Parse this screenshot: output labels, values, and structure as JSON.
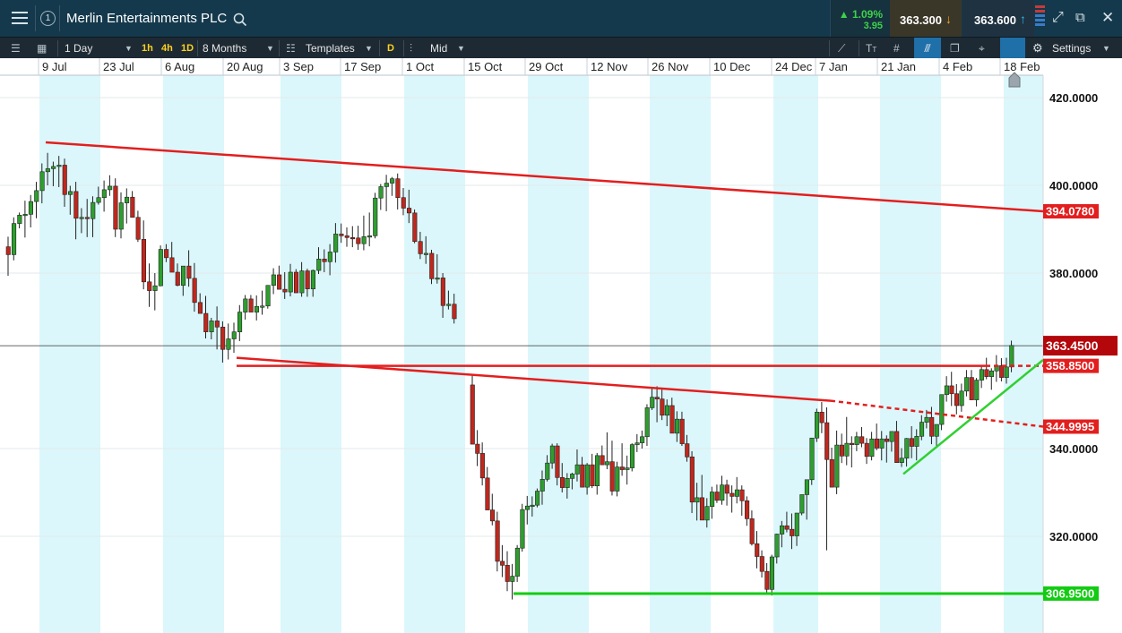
{
  "header": {
    "title": "Merlin Entertainments PLC",
    "badge_number": "1",
    "change_percent": "1.09%",
    "change_value": "3.95",
    "sell_price": "363.300",
    "buy_price": "363.600",
    "colors": {
      "bar": "#14394c",
      "up": "#3fd14a",
      "sell_bg": "#3a3a2e",
      "buy_bg": "#1f3140"
    }
  },
  "toolbar": {
    "interval": "1 Day",
    "quick_1h": "1h",
    "quick_4h": "4h",
    "quick_1d": "1D",
    "range": "8 Months",
    "templates": "Templates",
    "d_badge": "D",
    "price_type": "Mid",
    "text_tool": "T",
    "settings": "Settings"
  },
  "chart_data": {
    "type": "candlestick",
    "xlabels": [
      "9 Jul",
      "23 Jul",
      "6 Aug",
      "20 Aug",
      "3 Sep",
      "17 Sep",
      "1 Oct",
      "15 Oct",
      "29 Oct",
      "12 Nov",
      "26 Nov",
      "10 Dec",
      "24 Dec",
      "7 Jan",
      "21 Jan",
      "4 Feb",
      "18 Feb"
    ],
    "y_ticks": [
      "420.0000",
      "400.0000",
      "380.0000",
      "340.0000",
      "320.0000"
    ],
    "ylim": [
      294,
      425
    ],
    "current_price": "363.4500",
    "levels": [
      {
        "label": "394.0780",
        "color": "#e31e1e"
      },
      {
        "label": "358.8500",
        "color": "#e31e1e"
      },
      {
        "label": "344.9995",
        "color": "#e31e1e"
      },
      {
        "label": "306.9500",
        "color": "#12cc12"
      }
    ],
    "candles": [
      [
        386.0,
        388.3,
        379.4,
        384.2
      ],
      [
        384.2,
        392.7,
        382.9,
        391.3
      ],
      [
        391.3,
        393.8,
        390.2,
        393.2
      ],
      [
        393.2,
        396.5,
        388.1,
        393.4
      ],
      [
        393.4,
        397.8,
        390.4,
        396.3
      ],
      [
        396.3,
        400.8,
        392.5,
        398.8
      ],
      [
        398.8,
        405.0,
        395.9,
        403.1
      ],
      [
        403.1,
        407.4,
        400.0,
        403.8
      ],
      [
        403.8,
        405.4,
        399.8,
        404.3
      ],
      [
        404.3,
        406.7,
        399.6,
        404.6
      ],
      [
        404.6,
        406.1,
        395.1,
        397.9
      ],
      [
        397.9,
        399.9,
        393.3,
        398.6
      ],
      [
        398.6,
        400.8,
        387.7,
        392.5
      ],
      [
        392.5,
        394.8,
        389.1,
        392.7
      ],
      [
        392.7,
        396.9,
        388.2,
        392.4
      ],
      [
        392.4,
        397.5,
        388.2,
        396.1
      ],
      [
        396.1,
        399.7,
        395.6,
        397.2
      ],
      [
        397.2,
        401.1,
        394.0,
        399.0
      ],
      [
        399.0,
        402.3,
        397.6,
        399.8
      ],
      [
        399.8,
        401.6,
        388.2,
        390.0
      ],
      [
        390.0,
        398.4,
        387.9,
        396.0
      ],
      [
        396.0,
        399.3,
        391.3,
        397.3
      ],
      [
        397.3,
        398.7,
        393.0,
        392.7
      ],
      [
        392.7,
        394.2,
        387.1,
        387.7
      ],
      [
        387.7,
        392.0,
        376.3,
        378.0
      ],
      [
        378.0,
        382.2,
        372.3,
        376.0
      ],
      [
        376.0,
        380.0,
        371.5,
        377.1
      ],
      [
        377.1,
        386.3,
        377.0,
        385.4
      ],
      [
        385.4,
        386.6,
        382.5,
        383.5
      ],
      [
        383.5,
        387.1,
        382.1,
        380.2
      ],
      [
        380.2,
        382.2,
        377.0,
        377.2
      ],
      [
        377.2,
        381.0,
        374.8,
        381.6
      ],
      [
        381.6,
        385.2,
        376.9,
        378.8
      ],
      [
        378.8,
        382.3,
        371.2,
        373.3
      ],
      [
        373.3,
        375.4,
        371.6,
        370.8
      ],
      [
        370.8,
        374.8,
        365.1,
        366.6
      ],
      [
        366.6,
        369.8,
        364.9,
        369.1
      ],
      [
        369.1,
        372.4,
        362.6,
        367.7
      ],
      [
        367.7,
        369.0,
        359.6,
        362.6
      ],
      [
        362.6,
        368.5,
        360.3,
        365.0
      ],
      [
        365.0,
        368.7,
        361.8,
        366.6
      ],
      [
        366.6,
        372.7,
        364.5,
        371.1
      ],
      [
        371.1,
        375.0,
        369.4,
        374.1
      ],
      [
        374.1,
        375.0,
        371.6,
        371.1
      ],
      [
        371.1,
        374.9,
        369.2,
        372.4
      ],
      [
        372.4,
        376.0,
        370.5,
        372.5
      ],
      [
        372.5,
        377.1,
        371.9,
        377.2
      ],
      [
        377.2,
        381.1,
        375.2,
        379.6
      ],
      [
        379.6,
        381.7,
        376.6,
        376.3
      ],
      [
        376.3,
        380.2,
        374.1,
        375.7
      ],
      [
        375.7,
        382.1,
        374.7,
        380.2
      ],
      [
        380.2,
        380.9,
        375.6,
        375.5
      ],
      [
        375.5,
        382.5,
        374.6,
        380.5
      ],
      [
        380.5,
        381.0,
        374.6,
        376.4
      ],
      [
        376.4,
        380.8,
        374.6,
        380.6
      ],
      [
        380.6,
        385.9,
        379.8,
        383.2
      ],
      [
        383.2,
        385.4,
        380.2,
        382.6
      ],
      [
        382.6,
        386.6,
        379.5,
        384.8
      ],
      [
        384.8,
        391.4,
        382.4,
        388.9
      ],
      [
        388.9,
        391.3,
        386.9,
        388.5
      ],
      [
        388.5,
        390.4,
        386.0,
        388.1
      ],
      [
        388.1,
        390.7,
        385.9,
        388.0
      ],
      [
        388.0,
        390.8,
        385.3,
        386.7
      ],
      [
        386.7,
        393.1,
        385.2,
        388.3
      ],
      [
        388.3,
        393.8,
        386.1,
        388.5
      ],
      [
        388.5,
        398.3,
        387.9,
        397.1
      ],
      [
        397.1,
        400.3,
        394.4,
        399.7
      ],
      [
        399.7,
        402.4,
        394.1,
        400.5
      ],
      [
        400.5,
        401.9,
        397.6,
        401.5
      ],
      [
        401.5,
        402.7,
        394.5,
        397.2
      ],
      [
        397.2,
        399.4,
        393.2,
        394.8
      ],
      [
        394.8,
        399.0,
        391.4,
        393.7
      ],
      [
        393.7,
        394.5,
        386.8,
        387.2
      ],
      [
        387.2,
        389.4,
        383.2,
        384.4
      ],
      [
        384.4,
        388.4,
        382.1,
        384.5
      ],
      [
        384.5,
        385.3,
        377.5,
        378.7
      ],
      [
        378.7,
        384.3,
        377.6,
        378.9
      ],
      [
        378.9,
        380.0,
        369.8,
        372.6
      ],
      [
        372.6,
        376.0,
        371.7,
        372.9
      ],
      [
        372.9,
        375.3,
        368.5,
        369.6
      ]
    ],
    "candles2": [
      [
        354.5,
        357.0,
        345.0,
        341.0
      ],
      [
        341.0,
        344.2,
        336.0,
        338.9
      ],
      [
        338.9,
        341.4,
        331.6,
        333.3
      ],
      [
        333.3,
        335.8,
        330.0,
        326.0
      ],
      [
        326.0,
        329.7,
        322.5,
        323.5
      ],
      [
        323.5,
        325.6,
        312.0,
        314.3
      ],
      [
        314.3,
        318.0,
        310.7,
        313.4
      ],
      [
        313.4,
        316.6,
        307.5,
        309.7
      ],
      [
        309.7,
        313.7,
        305.6,
        310.9
      ],
      [
        310.9,
        318.0,
        309.6,
        317.3
      ],
      [
        317.3,
        327.4,
        316.5,
        326.1
      ],
      [
        326.1,
        329.2,
        322.7,
        326.9
      ],
      [
        326.9,
        329.1,
        324.5,
        327.1
      ],
      [
        327.1,
        330.9,
        326.6,
        330.3
      ],
      [
        330.3,
        335.0,
        327.2,
        333.0
      ],
      [
        333.0,
        338.5,
        332.5,
        336.7
      ],
      [
        336.7,
        341.1,
        335.4,
        340.6
      ],
      [
        340.6,
        341.2,
        331.6,
        333.4
      ],
      [
        333.4,
        336.7,
        330.0,
        331.1
      ],
      [
        331.1,
        334.4,
        328.6,
        333.2
      ],
      [
        333.2,
        334.5,
        330.7,
        334.2
      ],
      [
        334.2,
        339.8,
        332.5,
        336.3
      ],
      [
        336.3,
        338.1,
        332.0,
        331.2
      ],
      [
        331.2,
        336.7,
        329.5,
        336.3
      ],
      [
        336.3,
        338.8,
        331.0,
        331.5
      ],
      [
        331.5,
        339.0,
        329.5,
        338.4
      ],
      [
        338.4,
        340.7,
        336.7,
        336.3
      ],
      [
        336.3,
        343.7,
        335.3,
        337.0
      ],
      [
        337.0,
        341.8,
        329.3,
        330.3
      ],
      [
        330.3,
        337.0,
        329.1,
        335.8
      ],
      [
        335.8,
        341.2,
        333.8,
        335.2
      ],
      [
        335.2,
        338.4,
        331.8,
        335.6
      ],
      [
        335.6,
        341.2,
        334.8,
        340.9
      ],
      [
        340.9,
        343.3,
        339.2,
        341.3
      ],
      [
        341.3,
        344.1,
        340.0,
        342.7
      ],
      [
        342.7,
        350.1,
        340.6,
        349.3
      ],
      [
        349.3,
        353.8,
        348.8,
        351.7
      ],
      [
        351.7,
        354.2,
        346.0,
        351.3
      ],
      [
        351.3,
        353.5,
        346.5,
        347.6
      ],
      [
        347.6,
        351.2,
        345.1,
        349.8
      ],
      [
        349.8,
        351.6,
        346.2,
        343.5
      ],
      [
        343.5,
        348.5,
        341.5,
        346.7
      ],
      [
        346.7,
        348.4,
        340.6,
        341.1
      ],
      [
        341.1,
        343.1,
        337.0,
        338.1
      ],
      [
        338.1,
        339.4,
        325.3,
        327.8
      ],
      [
        327.8,
        332.2,
        323.6,
        328.8
      ],
      [
        328.8,
        334.0,
        325.6,
        323.7
      ],
      [
        323.7,
        328.7,
        322.0,
        326.8
      ],
      [
        326.8,
        331.3,
        324.0,
        330.1
      ],
      [
        330.1,
        331.8,
        327.6,
        328.2
      ],
      [
        328.2,
        333.8,
        327.2,
        331.7
      ],
      [
        331.7,
        332.9,
        327.0,
        329.8
      ],
      [
        329.8,
        331.6,
        325.4,
        329.1
      ],
      [
        329.1,
        333.5,
        327.5,
        330.6
      ],
      [
        330.6,
        331.6,
        324.7,
        328.1
      ],
      [
        328.1,
        329.1,
        322.4,
        324.0
      ],
      [
        324.0,
        325.9,
        317.9,
        318.3
      ],
      [
        318.3,
        321.2,
        312.7,
        315.4
      ],
      [
        315.4,
        316.8,
        310.6,
        312.0
      ],
      [
        312.0,
        313.9,
        306.7,
        307.9
      ],
      [
        307.9,
        315.8,
        306.5,
        315.3
      ],
      [
        315.3,
        320.6,
        313.8,
        320.5
      ],
      [
        320.5,
        323.5,
        317.5,
        322.4
      ],
      [
        322.4,
        325.6,
        320.9,
        321.6
      ],
      [
        321.6,
        325.2,
        317.1,
        320.1
      ],
      [
        320.1,
        323.8,
        317.8,
        325.3
      ],
      [
        325.3,
        328.8,
        324.8,
        329.5
      ],
      [
        329.5,
        332.7,
        323.8,
        332.9
      ],
      [
        332.9,
        337.6,
        331.7,
        342.4
      ],
      [
        342.4,
        349.1,
        341.5,
        348.3
      ],
      [
        348.3,
        350.6,
        343.5,
        345.9
      ],
      [
        345.9,
        349.4,
        316.8,
        337.5
      ],
      [
        337.5,
        340.2,
        331.7,
        331.2
      ],
      [
        331.2,
        344.1,
        329.6,
        340.8
      ],
      [
        340.8,
        343.4,
        336.7,
        338.3
      ],
      [
        338.3,
        347.2,
        336.2,
        341.2
      ],
      [
        341.2,
        342.8,
        335.7,
        340.9
      ],
      [
        340.9,
        343.8,
        339.4,
        342.7
      ],
      [
        342.7,
        344.9,
        340.3,
        341.2
      ],
      [
        341.2,
        342.4,
        336.5,
        338.2
      ],
      [
        338.2,
        343.8,
        337.3,
        342.2
      ],
      [
        342.2,
        345.7,
        339.6,
        340.1
      ],
      [
        340.1,
        344.0,
        337.3,
        342.2
      ],
      [
        342.2,
        343.0,
        336.8,
        341.6
      ],
      [
        341.6,
        343.3,
        339.3,
        343.9
      ],
      [
        343.9,
        346.3,
        338.1,
        336.8
      ],
      [
        336.8,
        340.1,
        335.8,
        337.8
      ],
      [
        337.8,
        342.4,
        335.9,
        342.3
      ],
      [
        342.3,
        345.1,
        337.8,
        340.5
      ],
      [
        340.5,
        344.4,
        337.3,
        342.8
      ],
      [
        342.8,
        347.6,
        341.9,
        346.0
      ],
      [
        346.0,
        348.8,
        344.6,
        347.1
      ],
      [
        347.1,
        349.5,
        341.0,
        342.8
      ],
      [
        342.8,
        345.4,
        340.6,
        345.5
      ],
      [
        345.5,
        349.7,
        344.2,
        352.3
      ],
      [
        352.3,
        356.5,
        350.7,
        354.3
      ],
      [
        354.3,
        357.5,
        349.7,
        352.5
      ],
      [
        352.5,
        354.7,
        347.8,
        349.8
      ],
      [
        349.8,
        354.8,
        348.4,
        353.1
      ],
      [
        353.1,
        357.9,
        351.9,
        356.2
      ],
      [
        356.2,
        357.9,
        351.8,
        351.1
      ],
      [
        351.1,
        356.1,
        349.6,
        355.6
      ],
      [
        355.6,
        359.0,
        353.8,
        358.0
      ],
      [
        358.0,
        360.7,
        355.8,
        356.4
      ],
      [
        356.4,
        358.3,
        353.4,
        357.7
      ],
      [
        357.7,
        361.3,
        355.2,
        358.9
      ],
      [
        358.9,
        360.6,
        355.3,
        356.2
      ],
      [
        356.2,
        360.7,
        354.8,
        358.6
      ],
      [
        358.6,
        364.6,
        357.4,
        363.5
      ]
    ]
  }
}
